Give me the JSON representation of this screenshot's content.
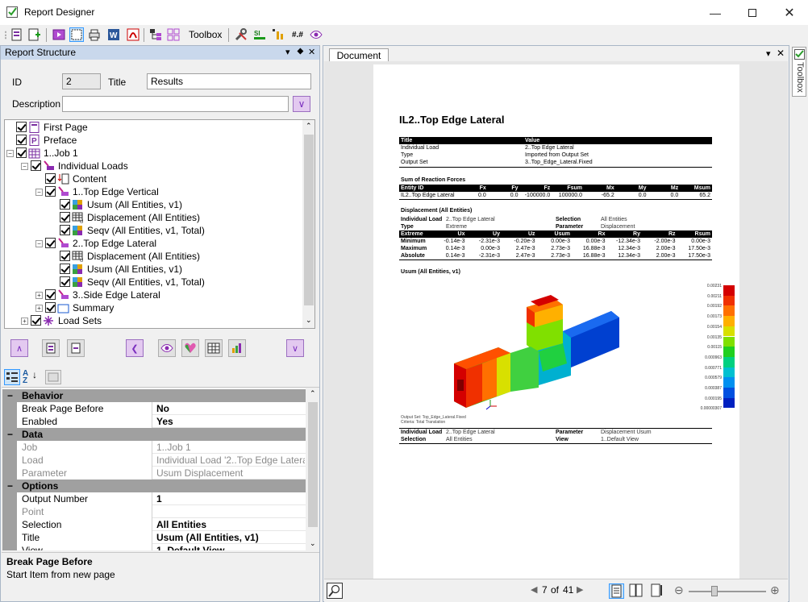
{
  "window": {
    "title": "Report Designer",
    "controls": [
      "minimize",
      "maximize",
      "close"
    ]
  },
  "toolbar": {
    "toolbox_label": "Toolbox",
    "sharp_label": "#.#"
  },
  "report_structure": {
    "header": "Report Structure",
    "id_label": "ID",
    "id_value": "2",
    "title_label": "Title",
    "title_value": "Results",
    "description_label": "Description",
    "description_value": "",
    "tree": [
      {
        "label": "First Page",
        "level": 0,
        "icon": "first-page-icon"
      },
      {
        "label": "Preface",
        "level": 0,
        "icon": "preface-icon"
      },
      {
        "label": "1..Job 1",
        "level": 0,
        "icon": "job-icon",
        "expander": "−"
      },
      {
        "label": "Individual Loads",
        "level": 1,
        "icon": "individual-loads-icon",
        "expander": "−"
      },
      {
        "label": "Content",
        "level": 2,
        "icon": "content-icon"
      },
      {
        "label": "1..Top Edge Vertical",
        "level": 2,
        "icon": "load-icon",
        "expander": "−"
      },
      {
        "label": "Usum (All Entities, v1)",
        "level": 3,
        "icon": "contour-icon"
      },
      {
        "label": "Displacement (All Entities)",
        "level": 3,
        "icon": "table-icon"
      },
      {
        "label": "Seqv (All Entities, v1, Total)",
        "level": 3,
        "icon": "contour-icon"
      },
      {
        "label": "2..Top Edge Lateral",
        "level": 2,
        "icon": "load-icon",
        "expander": "−"
      },
      {
        "label": "Displacement (All Entities)",
        "level": 3,
        "icon": "table-icon"
      },
      {
        "label": "Usum (All Entities, v1)",
        "level": 3,
        "icon": "contour-icon"
      },
      {
        "label": "Seqv (All Entities, v1, Total)",
        "level": 3,
        "icon": "contour-icon"
      },
      {
        "label": "3..Side Edge Lateral",
        "level": 2,
        "icon": "load-icon",
        "expander": "+"
      },
      {
        "label": "Summary",
        "level": 2,
        "icon": "summary-icon",
        "expander": "+"
      },
      {
        "label": "Load Sets",
        "level": 1,
        "icon": "load-sets-icon",
        "expander": "+"
      }
    ]
  },
  "properties": {
    "categories": {
      "behavior": "Behavior",
      "data": "Data",
      "options": "Options"
    },
    "behavior_rows": [
      {
        "name": "Break Page Before",
        "value": "No",
        "enabled": true
      },
      {
        "name": "Enabled",
        "value": "Yes",
        "enabled": true
      }
    ],
    "data_rows": [
      {
        "name": "Job",
        "value": "1..Job 1",
        "enabled": false
      },
      {
        "name": "Load",
        "value": "Individual Load '2..Top Edge Lateral'",
        "enabled": false
      },
      {
        "name": "Parameter",
        "value": "Usum Displacement",
        "enabled": false
      }
    ],
    "options_rows": [
      {
        "name": "Output Number",
        "value": "1",
        "enabled": true
      },
      {
        "name": "Point",
        "value": "",
        "enabled": false
      },
      {
        "name": "Selection",
        "value": "All Entities",
        "enabled": true
      },
      {
        "name": "Title",
        "value": "Usum (All Entities, v1)",
        "enabled": true
      },
      {
        "name": "View",
        "value": "1..Default View",
        "enabled": true
      }
    ],
    "help_title": "Break Page Before",
    "help_text": "Start Item from new page"
  },
  "document": {
    "tab_label": "Document",
    "page_title": "IL2..Top Edge Lateral",
    "info_table": {
      "headers": [
        "Title",
        "Value"
      ],
      "rows": [
        [
          "Individual Load",
          "2..Top Edge Lateral"
        ],
        [
          "Type",
          "Imported from Output Set"
        ],
        [
          "Output Set",
          "3..Top_Edge_Lateral.Fixed"
        ]
      ]
    },
    "reaction_title": "Sum of Reaction Forces",
    "reaction_table": {
      "headers": [
        "Entity ID",
        "Fx",
        "Fy",
        "Fz",
        "Fsum",
        "Mx",
        "My",
        "Mz",
        "Msum"
      ],
      "rows": [
        [
          "IL2..Top Edge Lateral",
          "0.0",
          "0.0",
          "-100000.0",
          "100000.0",
          "-65.2",
          "0.0",
          "0.0",
          "65.2"
        ]
      ]
    },
    "disp_title": "Displacement (All Entities)",
    "disp_meta": [
      [
        "Individual Load",
        "2..Top Edge Lateral",
        "Selection",
        "All Entities"
      ],
      [
        "Type",
        "Extreme",
        "Parameter",
        "Displacement"
      ]
    ],
    "disp_table": {
      "headers": [
        "Extreme",
        "Ux",
        "Uy",
        "Uz",
        "Usum",
        "Rx",
        "Ry",
        "Rz",
        "Rsum"
      ],
      "rows": [
        [
          "Minimum",
          "-0.14e-3",
          "-2.31e-3",
          "-0.20e-3",
          "0.00e-3",
          "0.00e-3",
          "-12.34e-3",
          "-2.00e-3",
          "0.00e-3"
        ],
        [
          "Maximum",
          "0.14e-3",
          "0.00e-3",
          "2.47e-3",
          "2.73e-3",
          "16.88e-3",
          "12.34e-3",
          "2.00e-3",
          "17.50e-3"
        ],
        [
          "Absolute",
          "0.14e-3",
          "-2.31e-3",
          "2.47e-3",
          "2.73e-3",
          "16.88e-3",
          "12.34e-3",
          "2.00e-3",
          "17.50e-3"
        ]
      ]
    },
    "usum_title": "Usum (All Entities, v1)",
    "legend_values": [
      "0.00231",
      "0.00211",
      "0.00192",
      "0.00173",
      "0.00154",
      "0.00135",
      "0.00115",
      "0.000963",
      "0.000771",
      "0.000579",
      "0.000387",
      "0.000195",
      "0.00000307"
    ],
    "legend_colors": [
      "#d40000",
      "#f03000",
      "#ff7000",
      "#ffb000",
      "#d8e000",
      "#80e000",
      "#20d020",
      "#00d080",
      "#00c0d0",
      "#0090f0",
      "#0050e0",
      "#0020c0",
      "#00109a"
    ],
    "caption_lines": [
      "Output Set: Top_Edge_Lateral.Fixed",
      "Criteria: Total Translation"
    ],
    "footer_meta": [
      [
        "Individual Load",
        "2..Top Edge Lateral",
        "Parameter",
        "Displacement Usum"
      ],
      [
        "Selection",
        "All Entities",
        "View",
        "1..Default View"
      ]
    ],
    "pager": {
      "current": "7",
      "of_label": "of",
      "total": "41"
    }
  },
  "rail": {
    "toolbox_label": "Toolbox"
  }
}
